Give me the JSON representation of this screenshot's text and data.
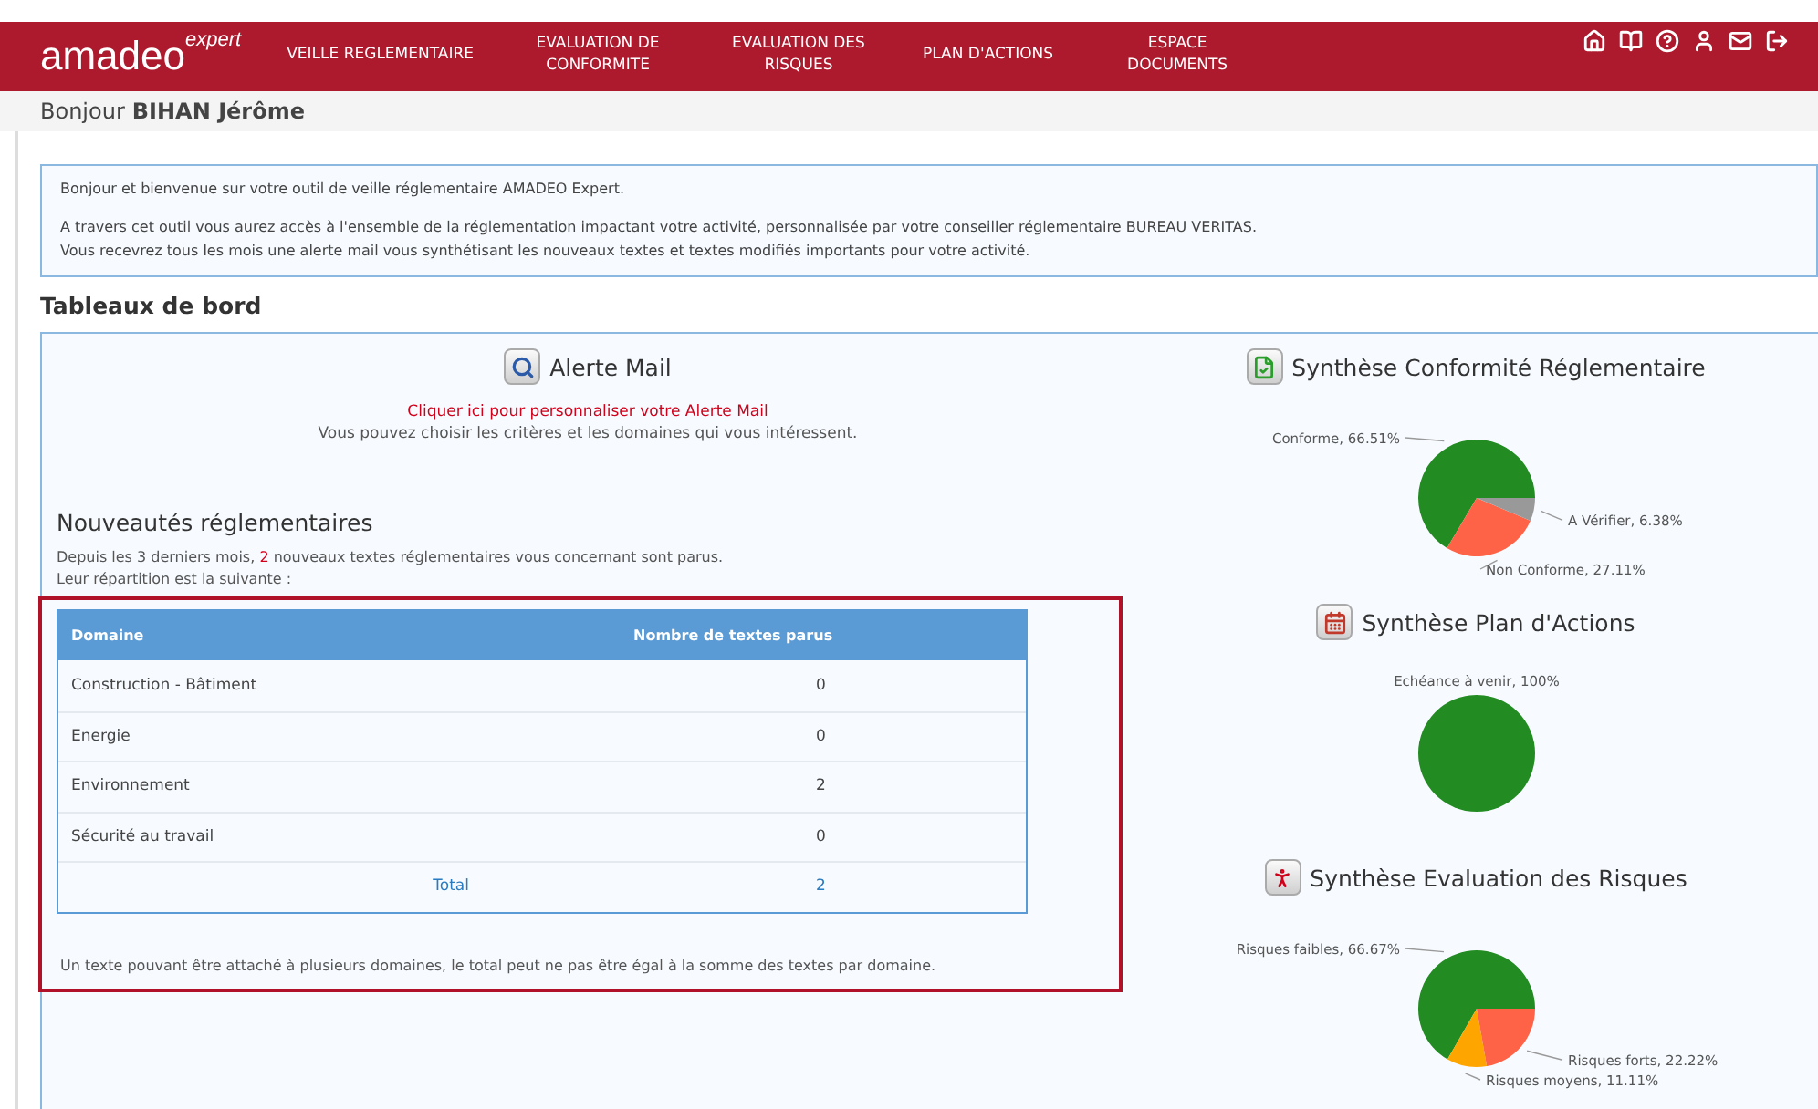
{
  "header": {
    "logo": "amadeo",
    "logo_sup": "expert",
    "nav": [
      {
        "label": "VEILLE REGLEMENTAIRE"
      },
      {
        "label": "EVALUATION DE CONFORMITE"
      },
      {
        "label": "EVALUATION DES RISQUES"
      },
      {
        "label": "PLAN D'ACTIONS"
      },
      {
        "label": "ESPACE DOCUMENTS"
      }
    ],
    "icons": [
      {
        "kind": "home"
      },
      {
        "kind": "book"
      },
      {
        "kind": "help"
      },
      {
        "kind": "user"
      },
      {
        "kind": "mail"
      },
      {
        "kind": "logout"
      }
    ]
  },
  "greeting": {
    "prefix": "Bonjour",
    "name": "BIHAN Jérôme"
  },
  "welcome": [
    "Bonjour et bienvenue sur votre outil de veille réglementaire AMADEO Expert.",
    "A travers cet outil vous aurez accès à l'ensemble de la réglementation impactant votre activité, personnalisée par votre conseiller réglementaire BUREAU VERITAS.",
    "Vous recevrez tous les mois une alerte mail vous synthétisant les nouveaux textes et textes modifiés importants pour votre activité."
  ],
  "dashboard_title": "Tableaux de bord",
  "alert": {
    "title": "Alerte Mail",
    "link": "Cliquer ici pour personnaliser votre Alerte Mail",
    "text": "Vous pouvez choisir les critères et les domaines qui vous intéressent."
  },
  "news": {
    "title": "Nouveautés réglementaires",
    "intro_before": "Depuis les 3 derniers mois, ",
    "intro_count": "2",
    "intro_after": " nouveaux textes réglementaires vous concernant sont parus.",
    "intro_line2": "Leur répartition est la suivante :",
    "columns": [
      "Domaine",
      "Nombre de textes parus"
    ],
    "rows": [
      {
        "domain": "Construction - Bâtiment",
        "count": "0"
      },
      {
        "domain": "Energie",
        "count": "0"
      },
      {
        "domain": "Environnement",
        "count": "2"
      },
      {
        "domain": "Sécurité au travail",
        "count": "0"
      }
    ],
    "total_label": "Total",
    "total": "2",
    "note": "Un texte pouvant être attaché à plusieurs domaines, le total peut ne pas être égal à la somme des textes par domaine."
  },
  "syntheses": [
    {
      "title": "Synthèse Conformité Réglementaire",
      "chart_data": {
        "type": "pie",
        "series": [
          {
            "values": [
              66.51,
              27.11,
              6.38
            ]
          }
        ],
        "colors": [
          "#228b22",
          "#ff6347",
          "#999999"
        ],
        "value_labels": [
          "Conforme, 66.51%",
          "Non Conforme, 27.11%",
          "A Vérifier, 6.38%"
        ]
      }
    },
    {
      "title": "Synthèse Plan d'Actions",
      "chart_data": {
        "type": "pie",
        "series": [
          {
            "values": [
              100
            ]
          }
        ],
        "colors": [
          "#228b22"
        ],
        "value_labels": [
          "Echéance à venir, 100%"
        ]
      }
    },
    {
      "title": "Synthèse Evaluation des Risques",
      "chart_data": {
        "type": "pie",
        "series": [
          {
            "values": [
              66.67,
              11.11,
              22.22
            ]
          }
        ],
        "colors": [
          "#228b22",
          "#ffa500",
          "#ff6347"
        ],
        "value_labels": [
          "Risques faibles, 66.67%",
          "Risques moyens, 11.11%",
          "Risques forts, 22.22%"
        ]
      }
    }
  ]
}
